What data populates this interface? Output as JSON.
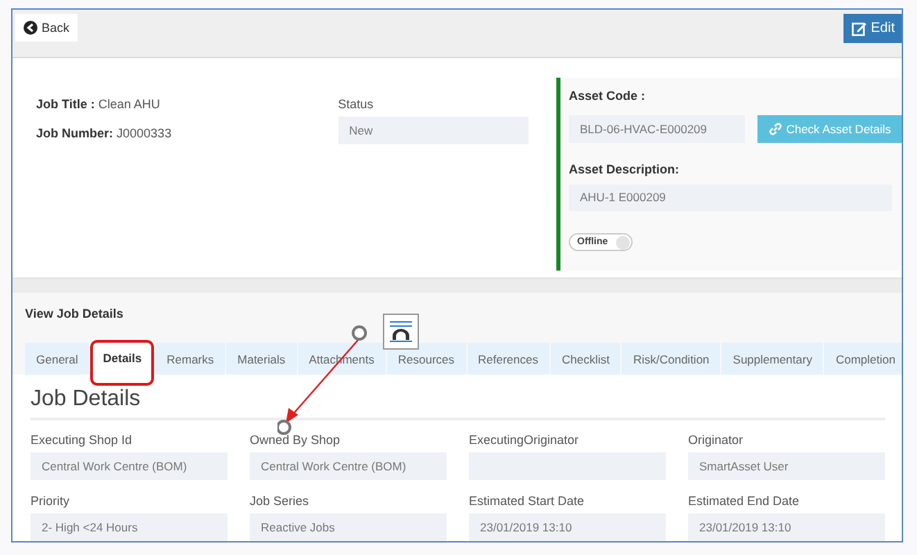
{
  "toolbar": {
    "back": "Back",
    "edit": "Edit"
  },
  "job": {
    "title_label": "Job Title :",
    "title": "Clean AHU",
    "number_label": "Job Number:",
    "number": "J0000333",
    "status_label": "Status",
    "status": "New"
  },
  "asset": {
    "code_label": "Asset Code :",
    "code": "BLD-06-HVAC-E000209",
    "check_button": "Check Asset Details",
    "description_label": "Asset Description:",
    "description": "AHU-1 E000209",
    "offline_toggle": {
      "label": "Offline",
      "on": false
    }
  },
  "section_title": "View Job Details",
  "tabs": [
    {
      "label": "General",
      "selected": false,
      "highlighted": false
    },
    {
      "label": "Details",
      "selected": true,
      "highlighted": true
    },
    {
      "label": "Remarks",
      "selected": false,
      "highlighted": false
    },
    {
      "label": "Materials",
      "selected": false,
      "highlighted": false
    },
    {
      "label": "Attachments",
      "selected": false,
      "highlighted": false
    },
    {
      "label": "Resources",
      "selected": false,
      "highlighted": false
    },
    {
      "label": "References",
      "selected": false,
      "highlighted": false
    },
    {
      "label": "Checklist",
      "selected": false,
      "highlighted": false
    },
    {
      "label": "Risk/Condition",
      "selected": false,
      "highlighted": false
    },
    {
      "label": "Supplementary",
      "selected": false,
      "highlighted": false
    },
    {
      "label": "Completion",
      "selected": false,
      "highlighted": false
    }
  ],
  "panel": {
    "heading": "Job Details",
    "fields": [
      {
        "label": "Executing Shop Id",
        "value": "Central Work Centre (BOM)"
      },
      {
        "label": "Owned By Shop",
        "value": "Central Work Centre (BOM)"
      },
      {
        "label": "ExecutingOriginator"
      },
      {
        "label": "Originator",
        "value": "SmartAsset User"
      },
      {
        "label": "Priority",
        "value": "2- High <24 Hours"
      },
      {
        "label": "Job Series",
        "value": "Reactive Jobs"
      },
      {
        "label": "Estimated Start Date",
        "value": "23/01/2019 13:10"
      },
      {
        "label": "Estimated End Date",
        "value": "23/01/2019 13:10"
      }
    ]
  }
}
